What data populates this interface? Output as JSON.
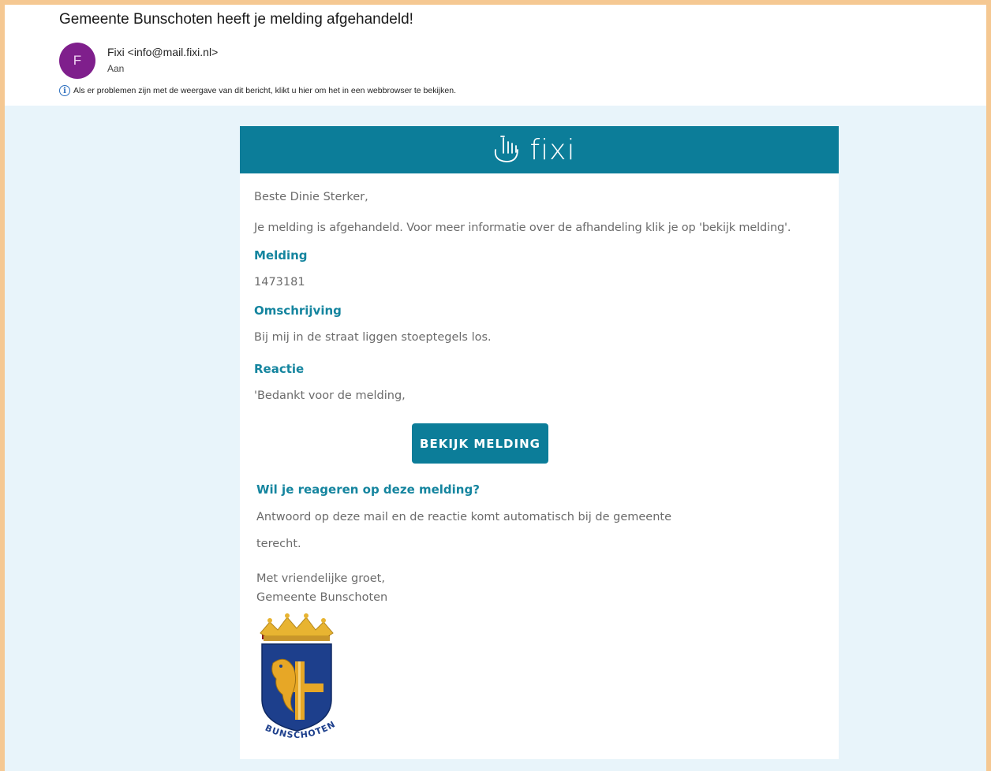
{
  "email": {
    "subject": "Gemeente Bunschoten heeft je melding afgehandeld!",
    "avatar_initial": "F",
    "avatar_color": "#7f1f8c",
    "sender": "Fixi <info@mail.fixi.nl>",
    "recipient_label": "Aan",
    "info_notice": "Als er problemen zijn met de weergave van dit bericht, klikt u hier om het in een webbrowser te bekijken."
  },
  "message": {
    "brand_name": "fixi",
    "brand_color": "#0c7d99",
    "greeting": "Beste Dinie Sterker,",
    "intro": "Je melding is afgehandeld. Voor meer informatie over de afhandeling klik je op 'bekijk melding'.",
    "melding_heading": "Melding",
    "melding_number": "1473181",
    "description_heading": "Omschrijving",
    "description": "Bij mij in de straat liggen stoeptegels los.",
    "reaction_heading": "Reactie",
    "reaction": "'Bedankt voor de melding,",
    "cta_label": "BEKIJK MELDING",
    "reply_heading": "Wil je reageren op deze melding?",
    "reply_text_line1": "Antwoord op deze mail en de reactie komt automatisch bij de gemeente",
    "reply_text_line2": "terecht.",
    "closing": "Met vriendelijke groet,",
    "signature": "Gemeente Bunschoten",
    "crest_text": "BUNSCHOTEN"
  }
}
